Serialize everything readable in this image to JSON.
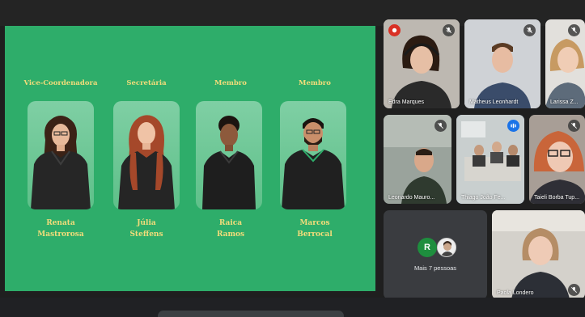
{
  "presentation": {
    "background": "#2ead6a",
    "text_color": "#f2dc7a",
    "members": [
      {
        "role": "Vice-Coordenadora",
        "first": "Renata",
        "last": "Mastrorosa"
      },
      {
        "role": "Secretária",
        "first": "Júlia",
        "last": "Steffens"
      },
      {
        "role": "Membro",
        "first": "Raica",
        "last": "Ramos"
      },
      {
        "role": "Membro",
        "first": "Marcos",
        "last": "Berrocal"
      }
    ]
  },
  "participants": [
    {
      "name": "Edra Marques",
      "icon": "mic-off-icon"
    },
    {
      "name": "Matheus Leonhardt",
      "icon": "mic-off-icon"
    },
    {
      "name": "Larissa Z...",
      "icon": "mic-off-icon"
    },
    {
      "name": "Leonardo Mauro...",
      "icon": "mic-off-icon"
    },
    {
      "name": "Thiago João Fe...",
      "icon": "speaking-icon"
    },
    {
      "name": "Taieli Borba Tup...",
      "icon": "mic-off-icon"
    },
    {
      "name": "Paola Londero",
      "icon": "mic-off-icon"
    }
  ],
  "more": {
    "initial": "R",
    "label": "Mais 7 pessoas"
  }
}
